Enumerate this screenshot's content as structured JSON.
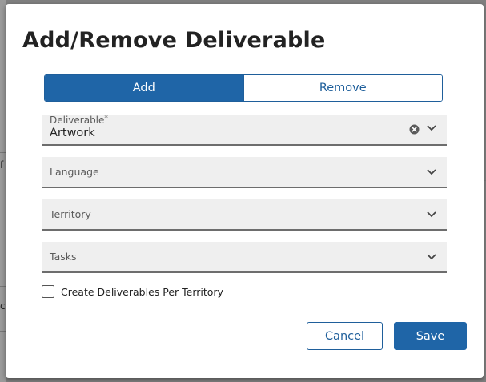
{
  "dialog": {
    "title": "Add/Remove Deliverable",
    "mode_tabs": [
      {
        "label": "Add",
        "active": true
      },
      {
        "label": "Remove",
        "active": false
      }
    ],
    "fields": {
      "deliverable": {
        "label": "Deliverable",
        "required_mark": "*",
        "value": "Artwork"
      },
      "language": {
        "label": "Language"
      },
      "territory": {
        "label": "Territory"
      },
      "tasks": {
        "label": "Tasks"
      }
    },
    "checkbox": {
      "label": "Create Deliverables Per Territory",
      "checked": false
    },
    "buttons": {
      "cancel": "Cancel",
      "save": "Save"
    }
  },
  "background": {
    "fragments": [
      "f",
      "c"
    ]
  },
  "colors": {
    "primary": "#1f65a7",
    "overlay": "#7f7f7f",
    "field_bg": "#efefef"
  },
  "icons": [
    "clear-icon",
    "chevron-down-icon",
    "checkbox"
  ]
}
